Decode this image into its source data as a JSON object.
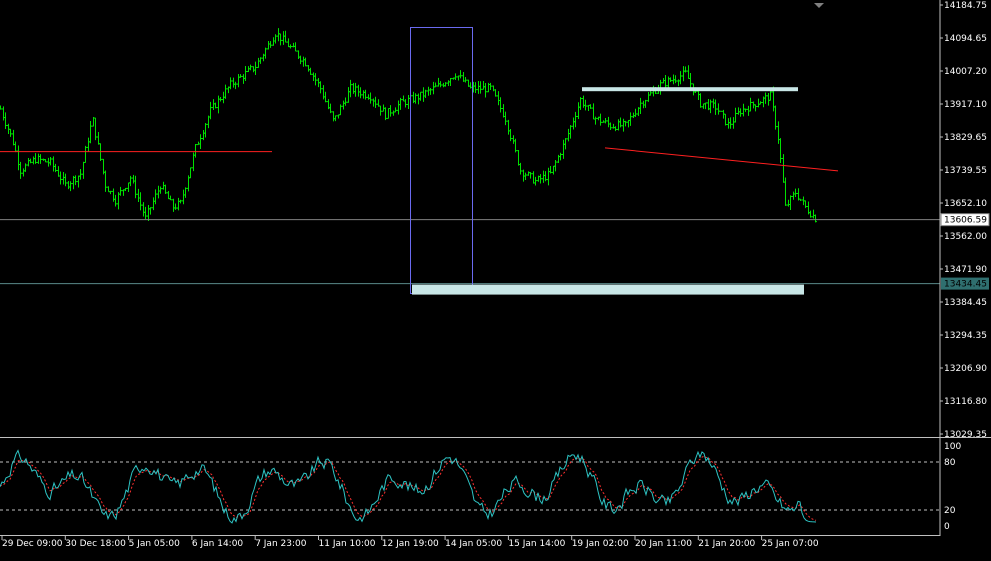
{
  "chart_data": {
    "type": "bar",
    "subtype": "ohlc",
    "price_axis": {
      "min": 13029.35,
      "max": 14184.75,
      "tick_labels": [
        "14184.75",
        "14094.65",
        "14007.20",
        "13917.10",
        "13829.65",
        "13739.55",
        "13652.10",
        "13562.00",
        "13471.90",
        "13384.45",
        "13294.35",
        "13206.90",
        "13116.80",
        "13029.35"
      ],
      "current_price_label": "13606.59",
      "level_label": "13434.45"
    },
    "time_axis": {
      "tick_labels": [
        "29 Dec 09:00",
        "30 Dec 18:00",
        "5 Jan 05:00",
        "6 Jan 14:00",
        "7 Jan 23:00",
        "11 Jan 10:00",
        "12 Jan 19:00",
        "14 Jan 05:00",
        "15 Jan 14:00",
        "19 Jan 02:00",
        "20 Jan 11:00",
        "21 Jan 20:00",
        "25 Jan 07:00"
      ]
    },
    "oscillator": {
      "type": "stochastic",
      "range": [
        0,
        100
      ],
      "levels": [
        20,
        80
      ],
      "tick_labels": [
        "100",
        "80",
        "20",
        "0"
      ]
    },
    "colors": {
      "background": "#000000",
      "bars": "#00e000",
      "main_line": "#2ec4c4",
      "signal_line": "#ff3030",
      "axis_text": "#ffffff",
      "grid_line": "#808080",
      "resistance_line": "#c8e6e6",
      "trend_line": "#ff2020",
      "range_box": "#6a6af0",
      "zone": "#c8e6e6"
    }
  }
}
